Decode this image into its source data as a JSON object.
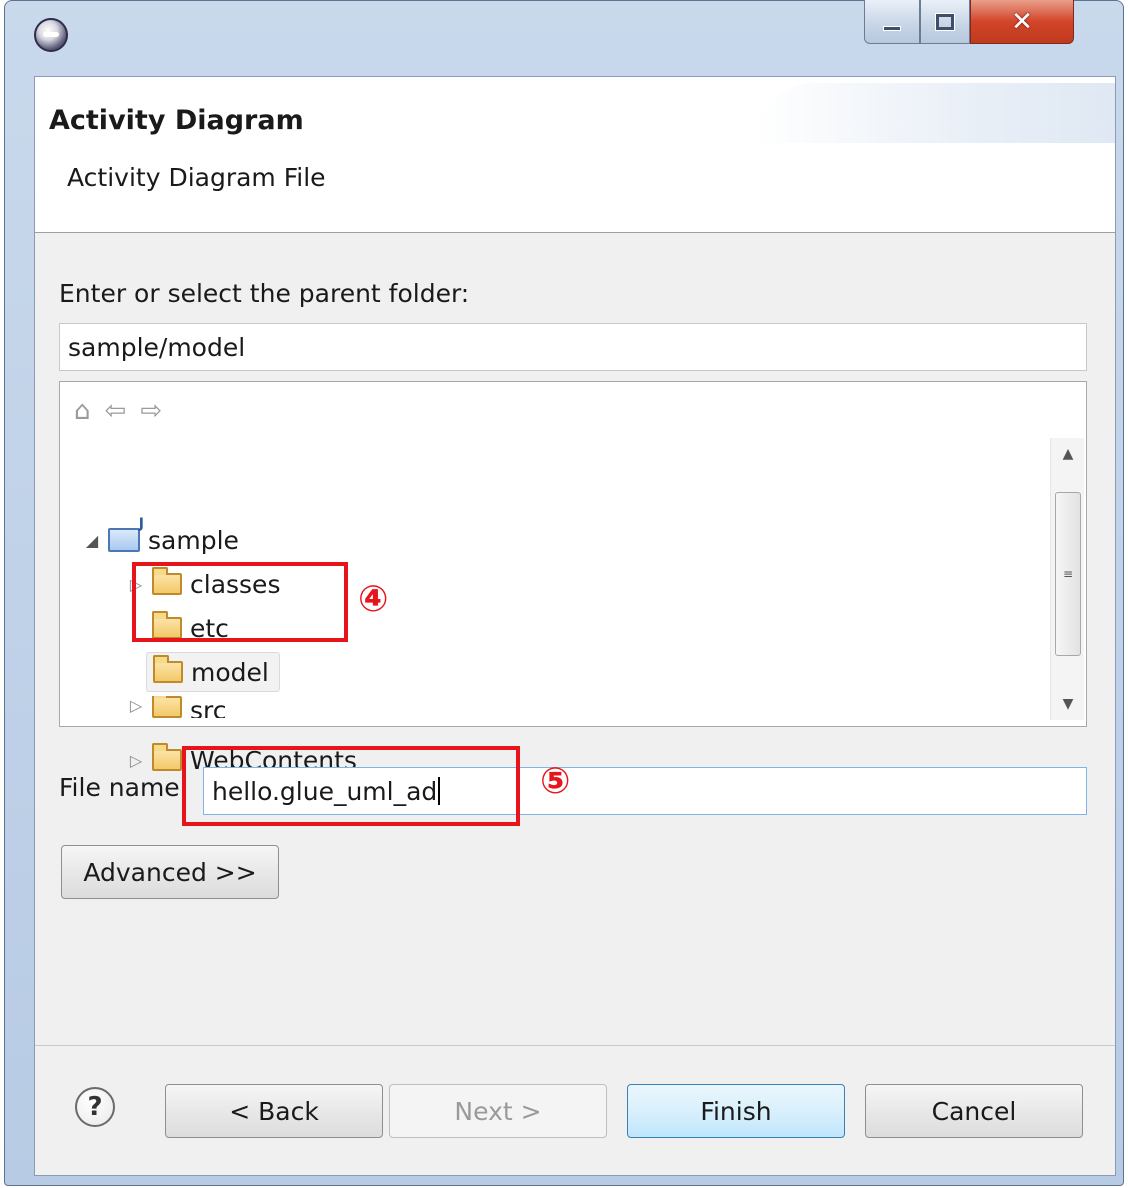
{
  "window": {
    "icon": "eclipse-gear-icon",
    "controls": {
      "minimize": "minimize-icon",
      "maximize": "maximize-icon",
      "close": "close-icon"
    }
  },
  "header": {
    "title": "Activity Diagram",
    "description": "Activity Diagram File"
  },
  "folder_section": {
    "label": "Enter or select the parent folder:",
    "value": "sample/model"
  },
  "navigator": {
    "icons": [
      "home-icon",
      "back-arrow-icon",
      "forward-arrow-icon"
    ],
    "tree": [
      {
        "label": "sample",
        "icon": "project-folder-icon",
        "expanded": true
      },
      {
        "label": "classes",
        "icon": "folder-icon",
        "expanded": false
      },
      {
        "label": "etc",
        "icon": "folder-icon"
      },
      {
        "label": "model",
        "icon": "folder-icon",
        "selected": true
      },
      {
        "label": "src",
        "icon": "folder-icon",
        "expanded": false
      },
      {
        "label": "WebContents",
        "icon": "folder-icon",
        "expanded": false
      }
    ]
  },
  "file": {
    "label": "File name:",
    "value": "hello.glue_uml_ad"
  },
  "buttons": {
    "advanced": "Advanced >>",
    "back": "< Back",
    "next": "Next >",
    "finish": "Finish",
    "cancel": "Cancel"
  },
  "annotations": {
    "four": "④",
    "five": "⑤",
    "color": "#e8141c"
  },
  "colors": {
    "finish_border": "#3c7fb1",
    "close_button": "#d2452a"
  }
}
